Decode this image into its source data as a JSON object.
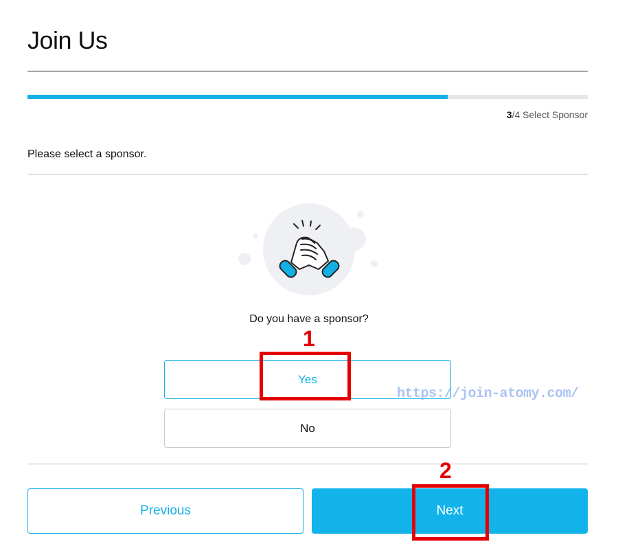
{
  "page": {
    "title": "Join Us"
  },
  "progress": {
    "step_current": "3",
    "step_rest": "/4 Select Sponsor",
    "fraction": 0.75,
    "color": "#13b0e6"
  },
  "form": {
    "prompt": "Please select a sponsor.",
    "question": "Do you have a sponsor?",
    "options": [
      {
        "label": "Yes",
        "selected": true
      },
      {
        "label": "No",
        "selected": false
      }
    ],
    "illustration_icon": "handshake-icon"
  },
  "navigation": {
    "previous_label": "Previous",
    "next_label": "Next"
  },
  "annotations": {
    "marker_1": "1",
    "marker_2": "2",
    "color": "#e40000"
  },
  "watermark": {
    "text": "https://join-atomy.com/"
  },
  "colors": {
    "accent": "#13b0e6",
    "annotation_red": "#e40000"
  }
}
